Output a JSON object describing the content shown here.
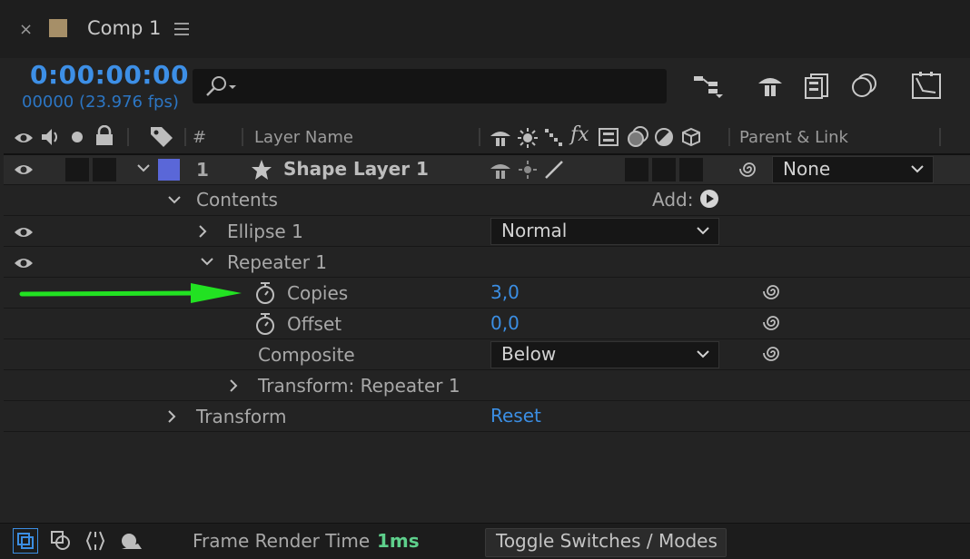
{
  "tab": {
    "close": "×",
    "title": "Comp 1"
  },
  "header": {
    "timecode": "0:00:00:00",
    "fps": "00000 (23.976 fps)",
    "search_placeholder": ""
  },
  "columns": {
    "number": "#",
    "layer_name": "Layer Name",
    "fx": "fx",
    "parent_link": "Parent & Link"
  },
  "layer": {
    "number": "1",
    "name": "Shape Layer 1",
    "color": "#5a67d8",
    "parent": "None"
  },
  "rows": {
    "contents": "Contents",
    "add_label": "Add:",
    "ellipse": "Ellipse 1",
    "ellipse_mode": "Normal",
    "repeater": "Repeater 1",
    "copies_label": "Copies",
    "copies_value": "3,0",
    "offset_label": "Offset",
    "offset_value": "0,0",
    "composite_label": "Composite",
    "composite_value": "Below",
    "transform_repeater": "Transform: Repeater 1",
    "transform": "Transform",
    "reset": "Reset"
  },
  "footer": {
    "frame_render_label": "Frame Render Time",
    "frame_render_value": "1ms",
    "toggle": "Toggle Switches / Modes"
  },
  "colors": {
    "accent_blue": "#3b8ee3",
    "green_value": "#5ed08c",
    "arrow": "#22e222",
    "swatch": "#a68f68"
  }
}
